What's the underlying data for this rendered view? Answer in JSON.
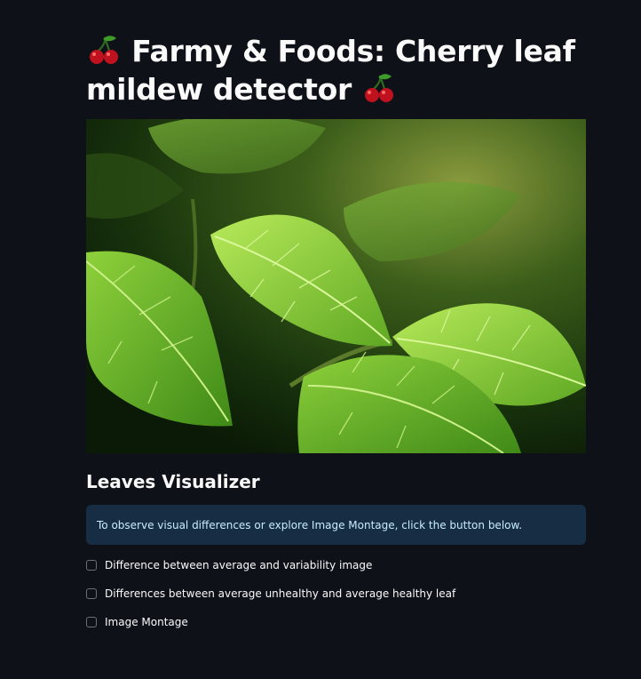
{
  "header": {
    "title": "Farmy & Foods: Cherry leaf mildew detector",
    "title_icon": "cherry-emoji"
  },
  "hero_image": {
    "description_icon": "green-leaves-photo"
  },
  "section": {
    "title": "Leaves Visualizer"
  },
  "info_box": {
    "text": "To observe visual differences or explore Image Montage, click the button below."
  },
  "checkboxes": [
    {
      "label": "Difference between average and variability image",
      "checked": false
    },
    {
      "label": "Differences between average unhealthy and average healthy leaf",
      "checked": false
    },
    {
      "label": "Image Montage",
      "checked": false
    }
  ],
  "colors": {
    "background": "#0e1117",
    "info_background": "#172d43",
    "info_text": "#c7ebff",
    "text": "#fafafa"
  }
}
